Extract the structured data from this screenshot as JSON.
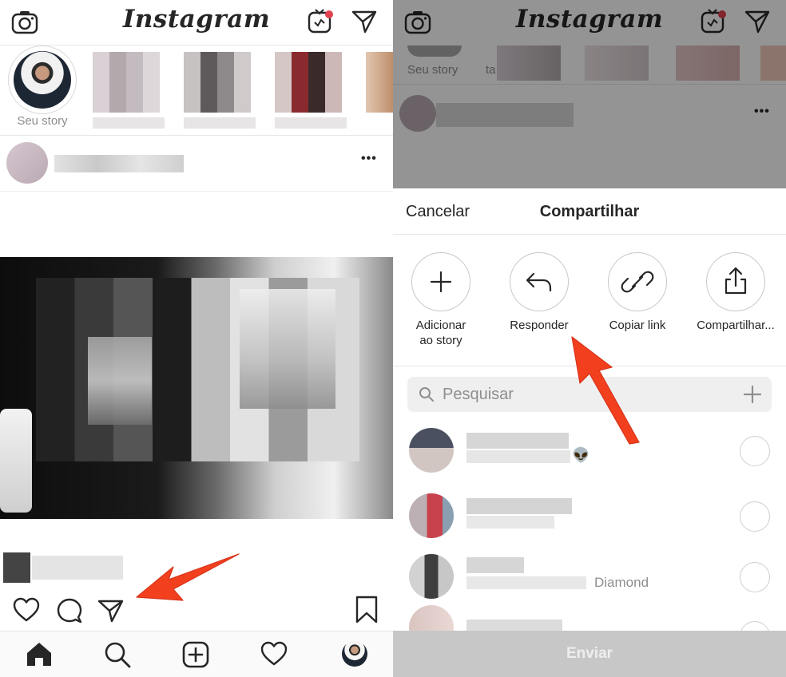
{
  "left_screen": {
    "app_title": "Instagram",
    "my_story_label": "Seu story",
    "icons": {
      "camera": "camera-icon",
      "igtv": "igtv-icon",
      "direct": "paper-plane-icon",
      "more": "more-options-icon",
      "like": "heart-icon",
      "comment": "comment-icon",
      "share": "paper-plane-icon",
      "save": "bookmark-icon",
      "home": "home-icon",
      "search": "search-icon",
      "new_post": "add-post-icon",
      "activity": "heart-icon",
      "profile": "profile-avatar"
    },
    "more_symbol": "•••"
  },
  "right_screen": {
    "app_title": "Instagram",
    "partial_story_label": "Seu story",
    "partial_story_label_2": "ta",
    "more_symbol": "•••",
    "sheet": {
      "cancel_label": "Cancelar",
      "title": "Compartilhar",
      "options": [
        {
          "label": "Adicionar\nao story",
          "icon": "plus-icon"
        },
        {
          "label": "Responder",
          "icon": "reply-icon"
        },
        {
          "label": "Copiar link",
          "icon": "link-icon"
        },
        {
          "label": "Compartilhar...",
          "icon": "share-icon"
        }
      ],
      "search_placeholder": "Pesquisar",
      "contacts": [
        {
          "suffix": "👽",
          "selected": false
        },
        {
          "suffix": "",
          "selected": false
        },
        {
          "suffix": "Diamond",
          "selected": false
        },
        {
          "suffix": "",
          "selected": false
        }
      ],
      "send_label": "Enviar"
    }
  },
  "colors": {
    "annotation_arrow": "#f2401f",
    "notification_dot": "#e0424f",
    "text_primary": "#262626",
    "text_secondary": "#8e8e8e"
  }
}
